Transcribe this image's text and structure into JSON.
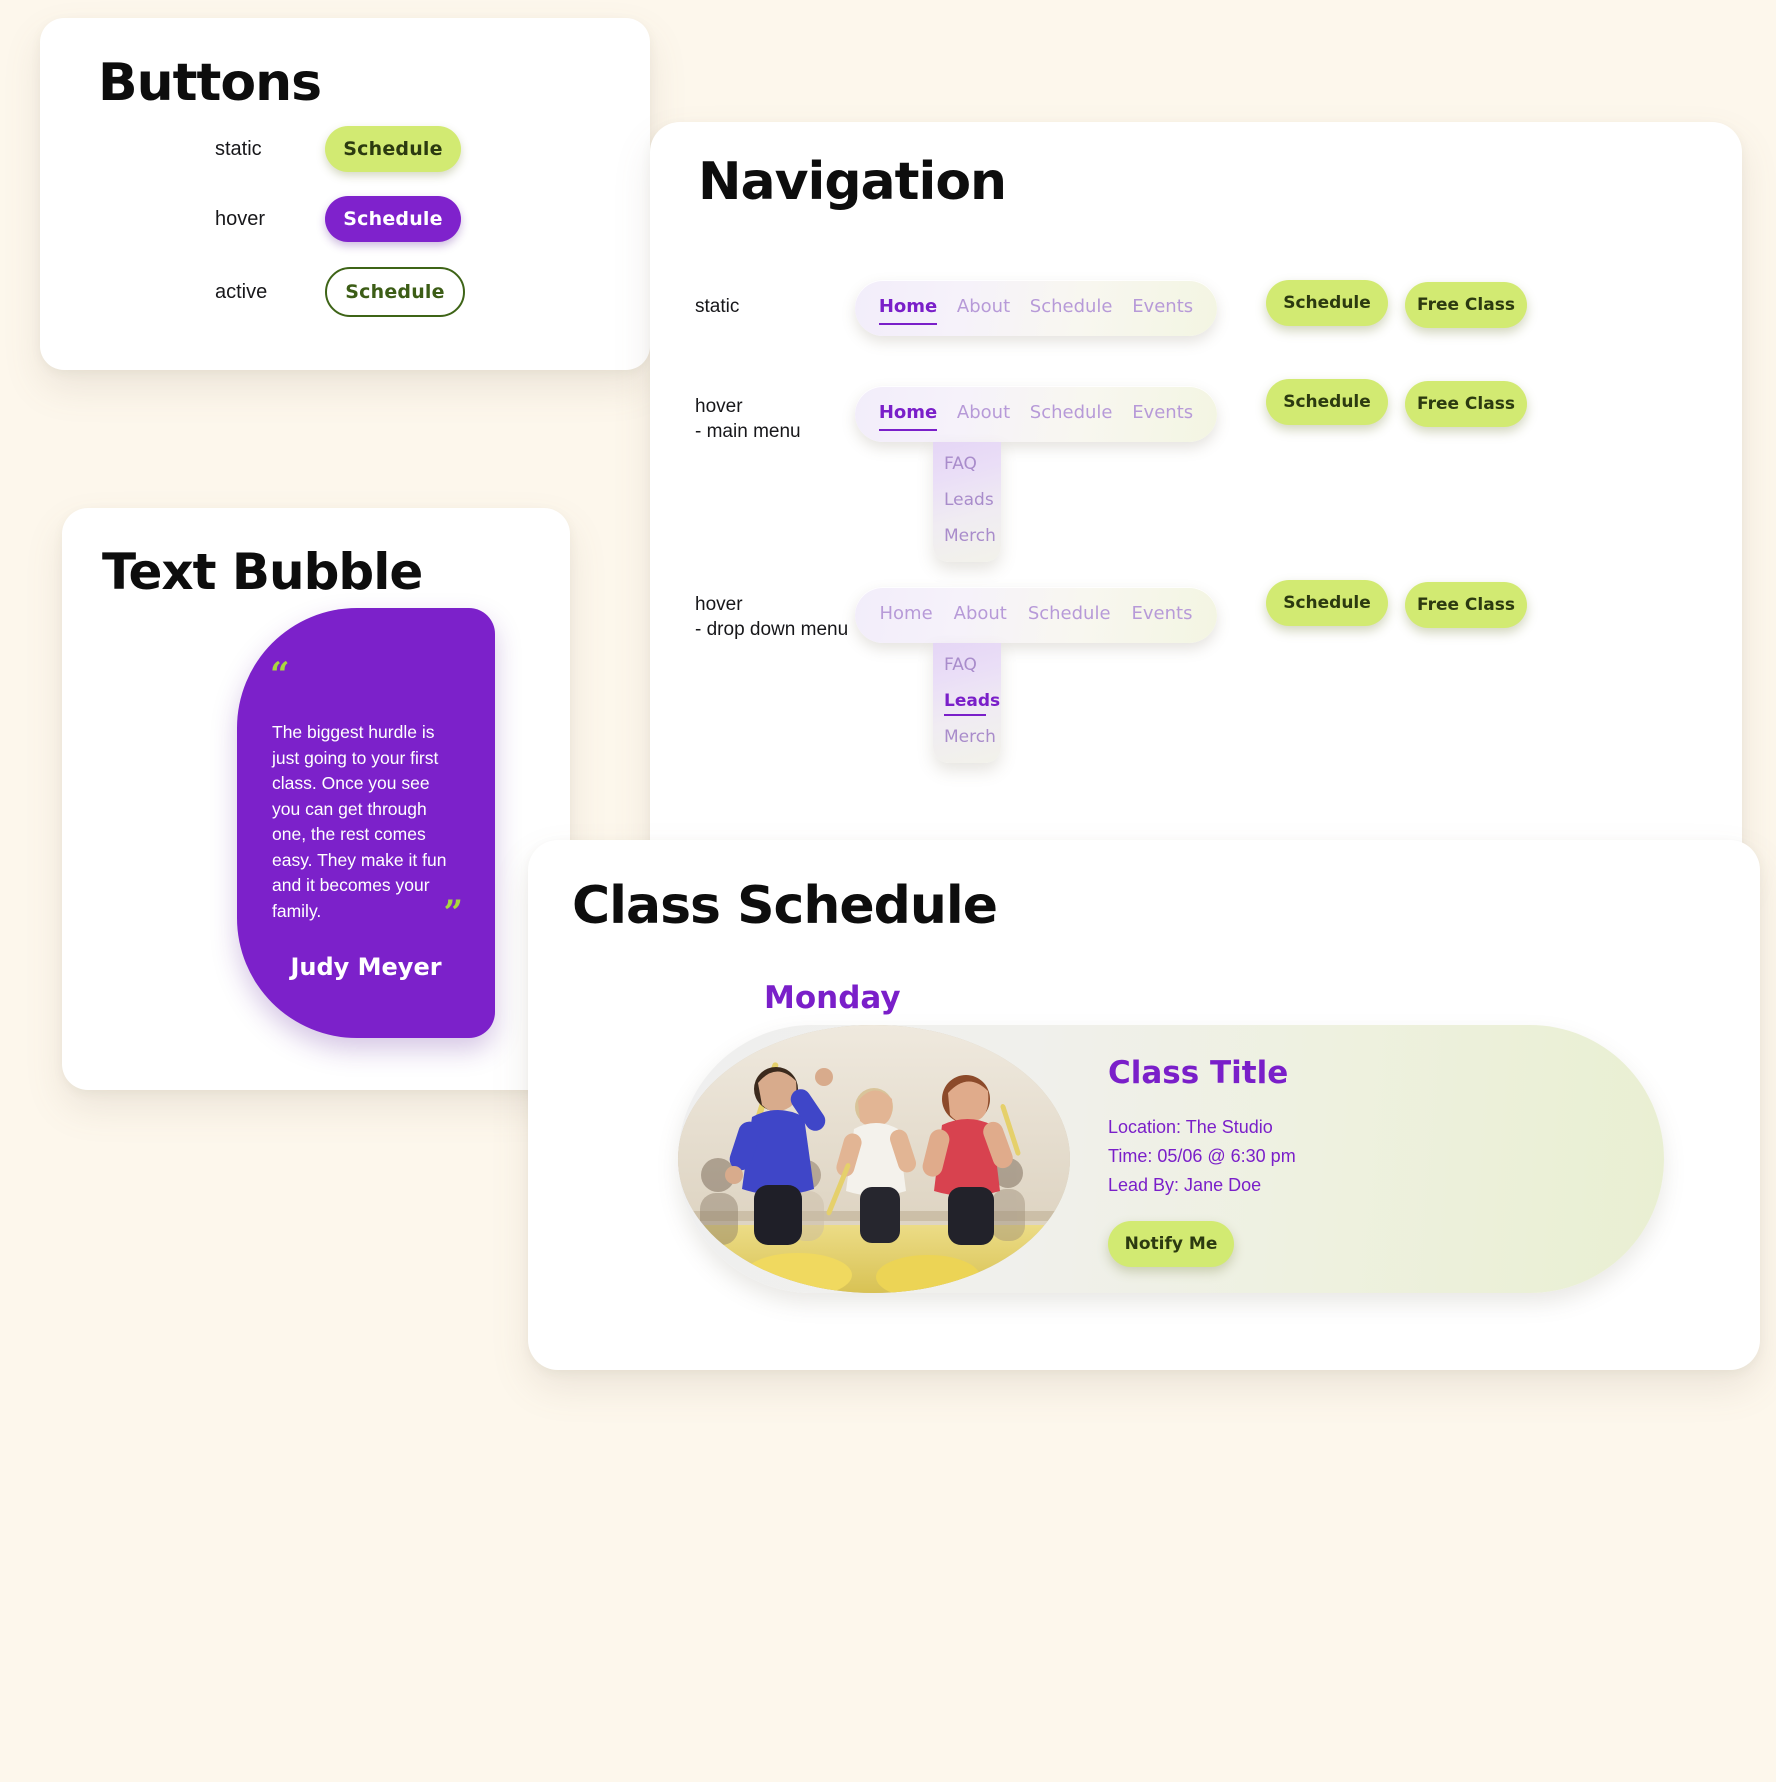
{
  "theme": {
    "background": "#fdf7ec",
    "green": "#d2ea72",
    "purple": "#7c21ca",
    "purple_text": "#7a1fc9",
    "lilac": "#b79ad8",
    "dark_green_text": "#2c3a10"
  },
  "buttons_section": {
    "title": "Buttons",
    "rows": [
      {
        "state": "static",
        "label": "Schedule"
      },
      {
        "state": "hover",
        "label": "Schedule"
      },
      {
        "state": "active",
        "label": "Schedule"
      }
    ]
  },
  "navigation_section": {
    "title": "Navigation",
    "rows": [
      {
        "state": "static",
        "links": [
          "Home",
          "About",
          "Schedule",
          "Events"
        ],
        "selected_link": "Home",
        "dropdown_visible": false,
        "dropdown_items": [],
        "selected_dropdown_item": "",
        "buttons": [
          "Schedule",
          "Free Class"
        ]
      },
      {
        "state": "hover\n- main menu",
        "links": [
          "Home",
          "About",
          "Schedule",
          "Events"
        ],
        "selected_link": "Home",
        "dropdown_visible": true,
        "dropdown_items": [
          "FAQ",
          "Leads",
          "Merch"
        ],
        "selected_dropdown_item": "",
        "buttons": [
          "Schedule",
          "Free Class"
        ]
      },
      {
        "state": "hover\n- drop down menu",
        "links": [
          "Home",
          "About",
          "Schedule",
          "Events"
        ],
        "selected_link": "",
        "dropdown_visible": true,
        "dropdown_items": [
          "FAQ",
          "Leads",
          "Merch"
        ],
        "selected_dropdown_item": "Leads",
        "buttons": [
          "Schedule",
          "Free Class"
        ]
      }
    ]
  },
  "text_bubble_section": {
    "title": "Text Bubble",
    "quote_open": "“",
    "quote_close": "”",
    "quote": "The biggest hurdle is just going to your first class. Once you see you can get through one, the rest comes easy. They make it fun and it becomes your family.",
    "author": "Judy Meyer"
  },
  "class_schedule_section": {
    "title": "Class Schedule",
    "day": "Monday",
    "class": {
      "name": "Class Title",
      "location": "Location:  The Studio",
      "time": "Time: 05/06 @ 6:30 pm",
      "lead_by": "Lead By: Jane Doe",
      "notify_label": "Notify Me",
      "photo_alt": "fitness class participants with drumsticks"
    }
  }
}
